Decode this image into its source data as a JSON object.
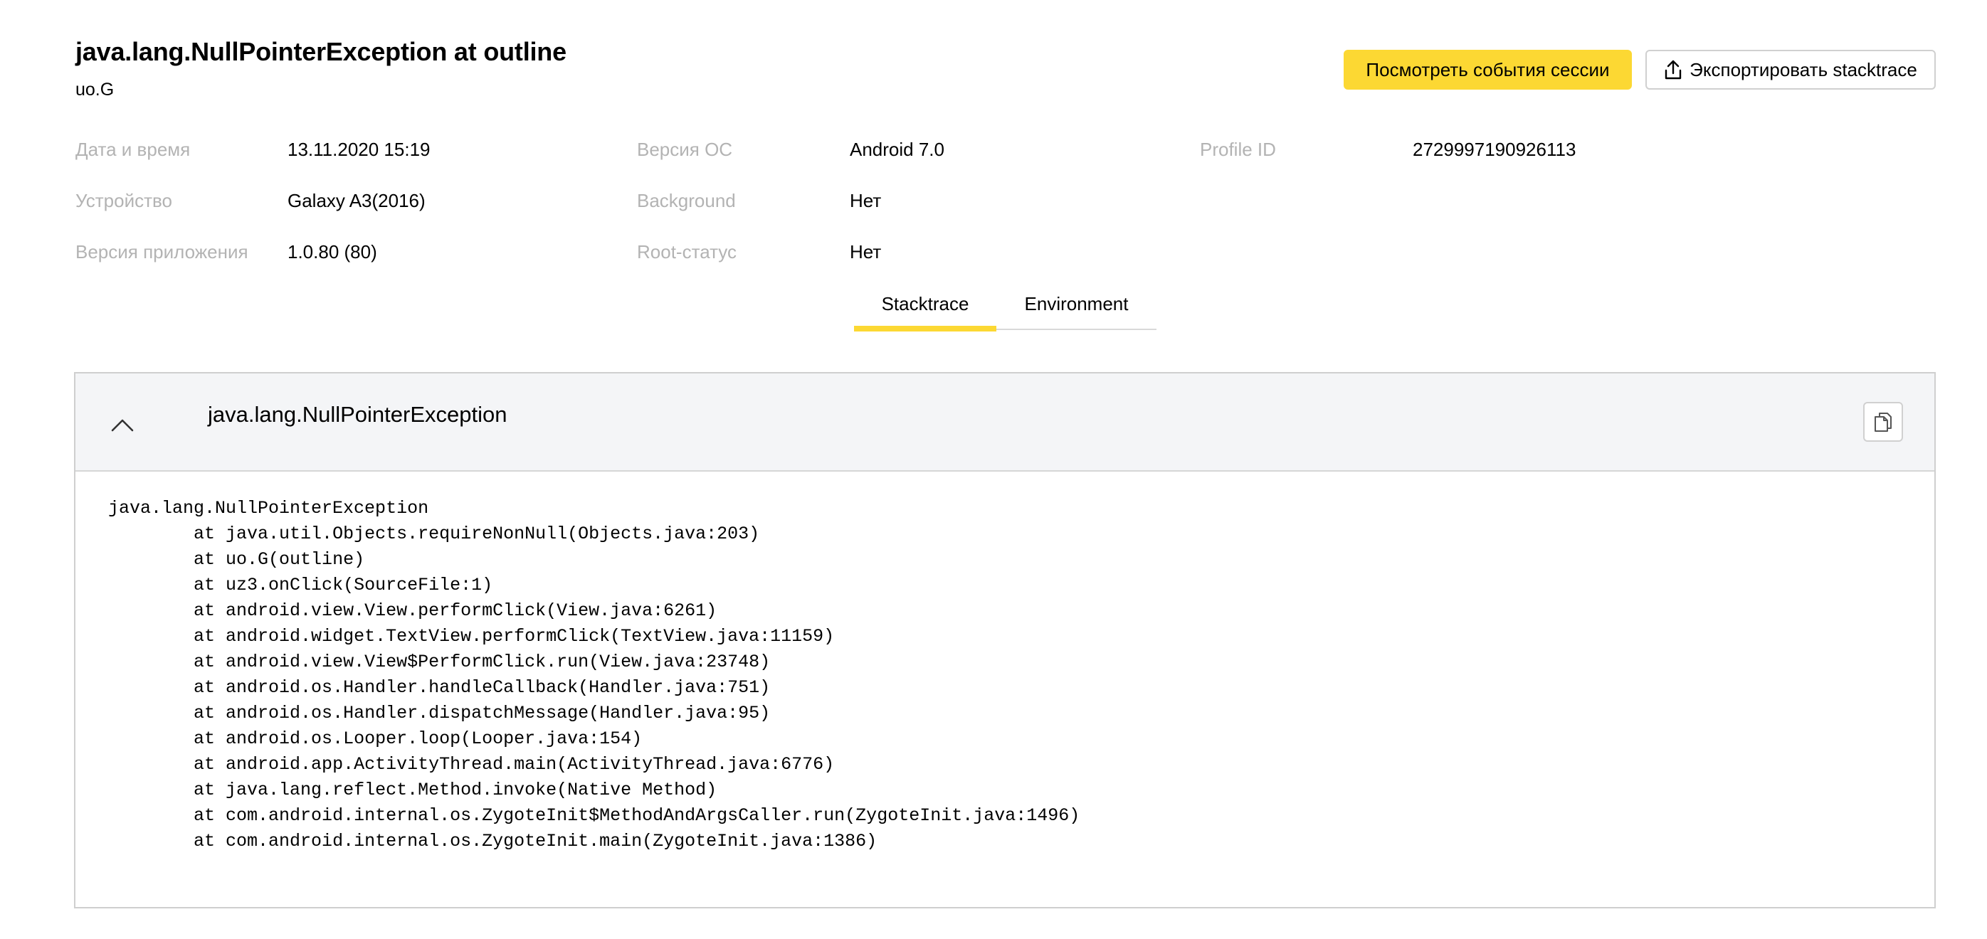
{
  "header": {
    "title": "java.lang.NullPointerException at outline",
    "subtitle": "uo.G"
  },
  "actions": {
    "view_session_events": "Посмотреть события сессии",
    "export_stacktrace": "Экспортировать stacktrace"
  },
  "info": {
    "datetime_label": "Дата и время",
    "datetime_value": "13.11.2020 15:19",
    "device_label": "Устройство",
    "device_value": "Galaxy A3(2016)",
    "app_version_label": "Версия приложения",
    "app_version_value": "1.0.80 (80)",
    "os_version_label": "Версия ОС",
    "os_version_value": "Android 7.0",
    "background_label": "Background",
    "background_value": "Нет",
    "root_label": "Root-статус",
    "root_value": "Нет",
    "profile_id_label": "Profile ID",
    "profile_id_value": "2729997190926113"
  },
  "tabs": {
    "stacktrace": "Stacktrace",
    "environment": "Environment",
    "active": "Stacktrace"
  },
  "panel": {
    "title": "java.lang.NullPointerException",
    "expanded": true,
    "stacktrace": "java.lang.NullPointerException\n\tat java.util.Objects.requireNonNull(Objects.java:203)\n\tat uo.G(outline)\n\tat uz3.onClick(SourceFile:1)\n\tat android.view.View.performClick(View.java:6261)\n\tat android.widget.TextView.performClick(TextView.java:11159)\n\tat android.view.View$PerformClick.run(View.java:23748)\n\tat android.os.Handler.handleCallback(Handler.java:751)\n\tat android.os.Handler.dispatchMessage(Handler.java:95)\n\tat android.os.Looper.loop(Looper.java:154)\n\tat android.app.ActivityThread.main(ActivityThread.java:6776)\n\tat java.lang.reflect.Method.invoke(Native Method)\n\tat com.android.internal.os.ZygoteInit$MethodAndArgsCaller.run(ZygoteInit.java:1496)\n\tat com.android.internal.os.ZygoteInit.main(ZygoteInit.java:1386)"
  },
  "icons": {
    "export": "upload-icon",
    "collapse": "chevron-up-icon",
    "copy": "copy-icon"
  },
  "colors": {
    "accent": "#fcd833",
    "label_gray": "#b3b3b3",
    "panel_header_bg": "#f4f5f7"
  }
}
